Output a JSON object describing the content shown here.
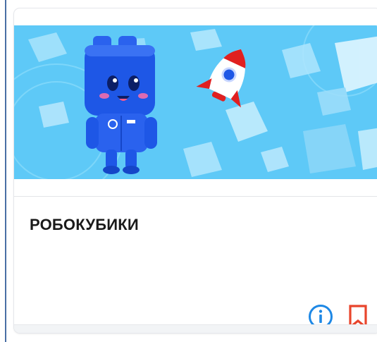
{
  "card": {
    "title": "РОБОКУБИКИ",
    "banner_image": "robot-cube-and-rocket-illustration",
    "icons": {
      "info": "info-circle-icon",
      "bookmark": "bookmark-icon"
    }
  },
  "colors": {
    "banner_bg": "#5ec9f7",
    "robot_blue": "#1e57e6",
    "info_icon": "#1e88e5",
    "bookmark_icon": "#e8452c",
    "title_text": "#1a1a1a"
  }
}
